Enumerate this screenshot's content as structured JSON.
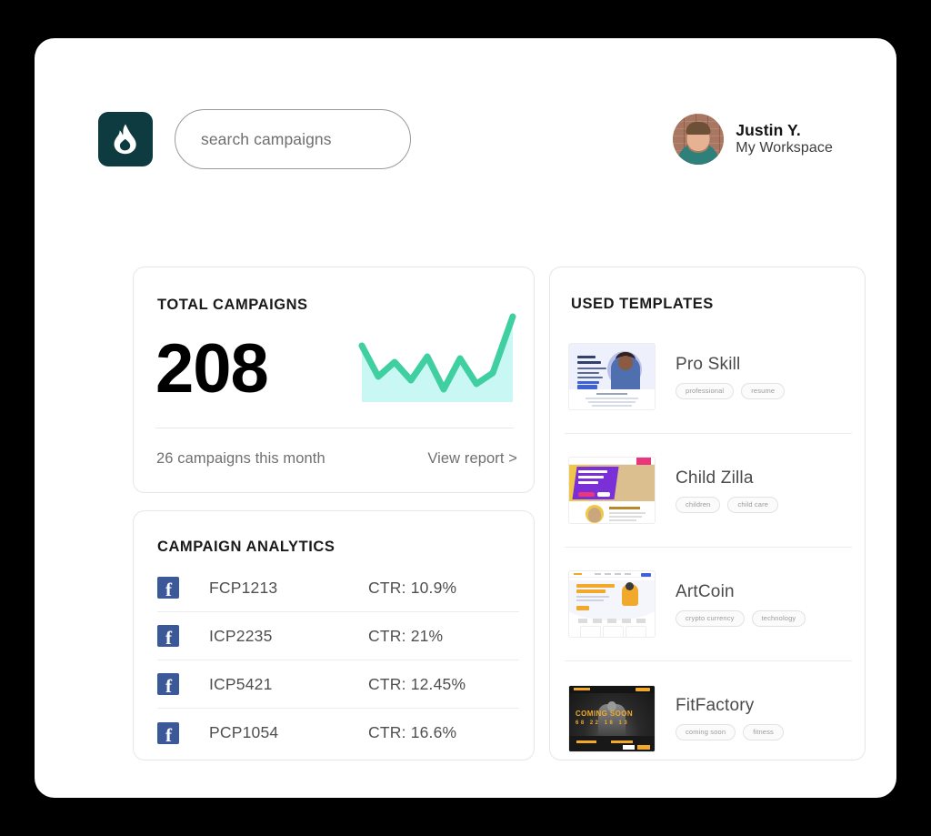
{
  "brand": {
    "logo_icon": "flame-icon",
    "logo_bg": "#0d3b40"
  },
  "search": {
    "placeholder": "search campaigns",
    "value": "",
    "icon": "search-input"
  },
  "user": {
    "name": "Justin Y.",
    "workspace": "My Workspace",
    "avatar": "user-avatar"
  },
  "total_campaigns": {
    "title": "TOTAL CAMPAIGNS",
    "count": "208",
    "footnote": "26 campaigns this month",
    "link": "View report >",
    "spark_color": "#3fcfa0",
    "spark_fill": "#c8f7f4"
  },
  "chart_data": {
    "type": "line",
    "title": "TOTAL CAMPAIGNS",
    "xlabel": "",
    "ylabel": "",
    "grid": false,
    "legend": null,
    "x": [
      0,
      1,
      2,
      3,
      4,
      5,
      6,
      7,
      8,
      9,
      10
    ],
    "series": [
      {
        "name": "campaigns",
        "values": [
          62,
          30,
          46,
          26,
          52,
          16,
          50,
          22,
          34,
          100
        ]
      }
    ],
    "ylim": [
      0,
      100
    ],
    "annotations": [
      "208 total",
      "26 campaigns this month"
    ]
  },
  "campaign_analytics": {
    "title": "CAMPAIGN ANALYTICS",
    "rows": [
      {
        "platform": "facebook",
        "id": "FCP1213",
        "ctr": "CTR: 10.9%"
      },
      {
        "platform": "facebook",
        "id": "ICP2235",
        "ctr": "CTR: 21%"
      },
      {
        "platform": "facebook",
        "id": "ICP5421",
        "ctr": "CTR: 12.45%"
      },
      {
        "platform": "facebook",
        "id": "PCP1054",
        "ctr": "CTR: 16.6%"
      }
    ]
  },
  "used_templates": {
    "title": "USED TEMPLATES",
    "rows": [
      {
        "name": "Pro Skill",
        "tags": [
          "professional",
          "resume"
        ]
      },
      {
        "name": "Child Zilla",
        "tags": [
          "children",
          "child care"
        ]
      },
      {
        "name": "ArtCoin",
        "tags": [
          "crypto currency",
          "technology"
        ]
      },
      {
        "name": "FitFactory",
        "tags": [
          "coming soon",
          "fitness"
        ]
      }
    ]
  },
  "thumb_text": {
    "proskill_hello": "Hello,",
    "proskill_name": "I Am Sofia",
    "child_hero": "BEST PLACE TO EXPLORE AND LEARN",
    "art_title": "Cryptocurrency",
    "art_sub": "technology",
    "fit_soon": "COMING SOON",
    "fit_counter": "68 22 18 13"
  }
}
